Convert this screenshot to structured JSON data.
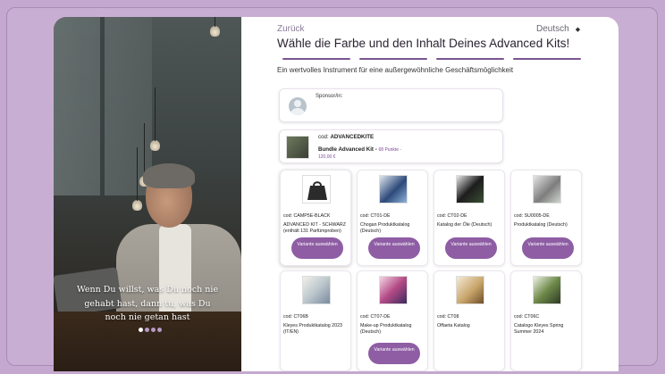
{
  "header": {
    "back_label": "Zurück",
    "language": "Deutsch",
    "language_caret": "◆",
    "title": "Wähle die Farbe und den Inhalt Deines Advanced Kits!",
    "subtitle": "Ein wertvolles Instrument für eine außergewöhnliche Geschäftsmöglichkeit"
  },
  "hero": {
    "quote_line1": "Wenn Du willst, was Du noch nie",
    "quote_line2": "gehabt hast, dann tu, was Du",
    "quote_line3": "noch nie getan hast"
  },
  "sponsor": {
    "label": "Sponsor/in:"
  },
  "kit": {
    "cod_prefix": "cod:",
    "cod": "ADVANCEDKITE",
    "name": "Bundle Advanced Kit -",
    "points": "68 Punkte -",
    "price": "120,00 €"
  },
  "colors": {
    "accent": "#8e5da4",
    "step_bar": "#7b5592"
  },
  "products": [
    {
      "cod": "cod: CAMP5E-BLACK",
      "name": "ADVANCED KIT - SCHWARZ (enthält 131 Parfümproben)",
      "button": "Variante auswählen",
      "image": "black-bag"
    },
    {
      "cod": "cod: CT01-DE",
      "name": "Chogan Produktkatalog (Deutsch)",
      "button": "Variante auswählen",
      "image": "catalog-blue"
    },
    {
      "cod": "cod: CT02-DE",
      "name": "Katalog der Öle (Deutsch)",
      "button": "Variante auswählen",
      "image": "catalog-dark"
    },
    {
      "cod": "cod: SU0005-DE",
      "name": "Produktkatalog (Deutsch)",
      "button": "Variante auswählen",
      "image": "catalog-grey"
    },
    {
      "cod": "cod: CT06B",
      "name": "Kleyes Produktkatalog 2023 (IT/EN)",
      "button": "",
      "image": "catalog-light"
    },
    {
      "cod": "cod: CT07-DE",
      "name": "Make-up Produktkatalog (Deutsch)",
      "button": "Variante auswählen",
      "image": "catalog-pink"
    },
    {
      "cod": "cod: CT08",
      "name": "Offaeta Katalog",
      "button": "",
      "image": "catalog-beige"
    },
    {
      "cod": "cod: CT06C",
      "name": "Catalogo Kleyes Spring Summer 2024",
      "button": "",
      "image": "catalog-green"
    }
  ]
}
